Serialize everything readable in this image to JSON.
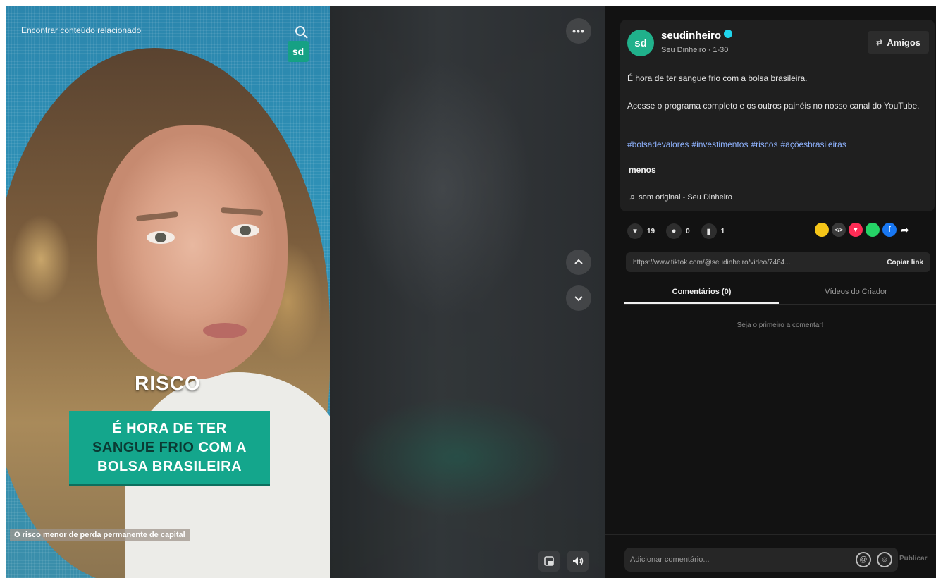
{
  "video": {
    "search_text": "Encontrar conteúdo relacionado",
    "badge_logo": "sd",
    "caption_top": "RISCO",
    "caption_line1": "É HORA DE TER",
    "caption_line2_highlight": "SANGUE FRIO",
    "caption_line2_rest": " COM A",
    "caption_line3": "BOLSA BRASILEIRA",
    "sub_label": "O risco menor de perda permanente de capital",
    "more_label": "•••"
  },
  "post": {
    "avatar": "sd",
    "username": "seudinheiro",
    "subline": "Seu Dinheiro · 1-30",
    "friends_label": "Amigos",
    "description_1": "É hora de ter sangue frio com a bolsa brasileira.",
    "description_2": "Acesse o programa completo e os outros painéis no nosso canal do YouTube.",
    "hashtags": [
      "#bolsadevalores",
      "#investimentos",
      "#riscos",
      "#açõesbrasileiras"
    ],
    "less_label": "menos",
    "sound": "som original - Seu Dinheiro"
  },
  "stats": {
    "likes": "19",
    "comments": "0",
    "saves": "1"
  },
  "share": {
    "colors": [
      "#f5c518",
      "#3a3a3a",
      "#fe2c55",
      "#25d366",
      "#1877f2"
    ],
    "icons": [
      "friends-share-icon",
      "embed-icon",
      "tiktok-repost-icon",
      "whatsapp-icon",
      "facebook-icon"
    ],
    "glyphs": [
      "•",
      "</>",
      "▼",
      "●",
      "f"
    ]
  },
  "link": {
    "url": "https://www.tiktok.com/@seudinheiro/video/7464...",
    "copy_label": "Copiar link"
  },
  "tabs": {
    "comments": "Comentários (0)",
    "creator_videos": "Vídeos do Criador"
  },
  "comments": {
    "empty": "Seja o primeiro a comentar!",
    "placeholder": "Adicionar comentário...",
    "post_label": "Publicar"
  }
}
